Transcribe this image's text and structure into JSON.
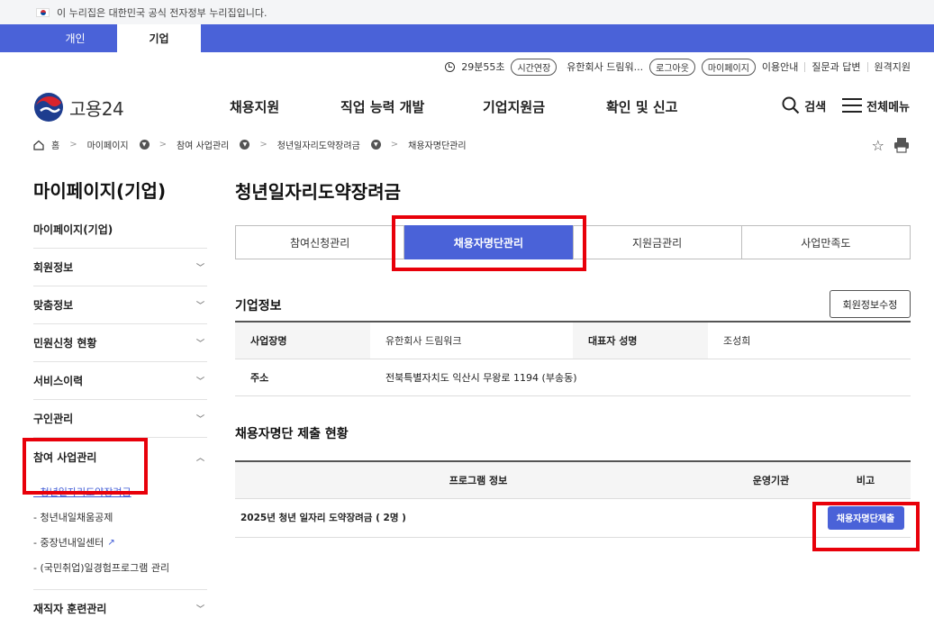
{
  "gov_banner": {
    "text": "이 누리집은 대한민국 공식 전자정부 누리집입니다."
  },
  "audience_tabs": [
    "개인",
    "기업"
  ],
  "utility": {
    "timer": "29분55초",
    "extend_label": "시간연장",
    "company": "유한회사 드림워...",
    "logout_label": "로그아웃",
    "mypage_label": "마이페이지",
    "links": [
      "이용안내",
      "질문과 답변",
      "원격지원"
    ]
  },
  "header": {
    "logo_text": "고용24",
    "nav": [
      "채용지원",
      "직업 능력 개발",
      "기업지원금",
      "확인 및 신고"
    ],
    "search_label": "검색",
    "menu_label": "전체메뉴"
  },
  "breadcrumb": [
    "홈",
    "마이페이지",
    "참여 사업관리",
    "청년일자리도약장려금",
    "채용자명단관리"
  ],
  "sidebar": {
    "title": "마이페이지(기업)",
    "items": [
      {
        "label": "마이페이지(기업)"
      },
      {
        "label": "회원정보"
      },
      {
        "label": "맞춤정보"
      },
      {
        "label": "민원신청 현황"
      },
      {
        "label": "서비스이력"
      },
      {
        "label": "구인관리"
      },
      {
        "label": "참여 사업관리"
      }
    ],
    "sub_items": [
      "- 청년일자리도약장려금",
      "- 청년내일채움공제",
      "- 중장년내일센터",
      "- (국민취업)일경험프로그램 관리"
    ],
    "after_items": [
      {
        "label": "재직자 훈련관리"
      }
    ]
  },
  "content": {
    "page_title": "청년일자리도약장려금",
    "tabs": [
      "참여신청관리",
      "채용자명단관리",
      "지원금관리",
      "사업만족도"
    ],
    "company_section": {
      "title": "기업정보",
      "edit_label": "회원정보수정",
      "rows": [
        {
          "label": "사업장명",
          "value": "유한회사 드림워크",
          "label2": "대표자 성명",
          "value2": "조성희"
        },
        {
          "label": "주소",
          "value": "전북특별자치도 익산시 무왕로 1194 (부송동)"
        }
      ]
    },
    "submission_section": {
      "title": "채용자명단 제출 현황",
      "columns": [
        "프로그램 정보",
        "운영기관",
        "비고"
      ],
      "rows": [
        {
          "program": "2025년 청년 일자리 도약장려금 ( 2명 )",
          "agency": "",
          "action_label": "채용자명단제출"
        }
      ]
    }
  },
  "colors": {
    "primary": "#4a62d8",
    "highlight": "#e8000a"
  }
}
